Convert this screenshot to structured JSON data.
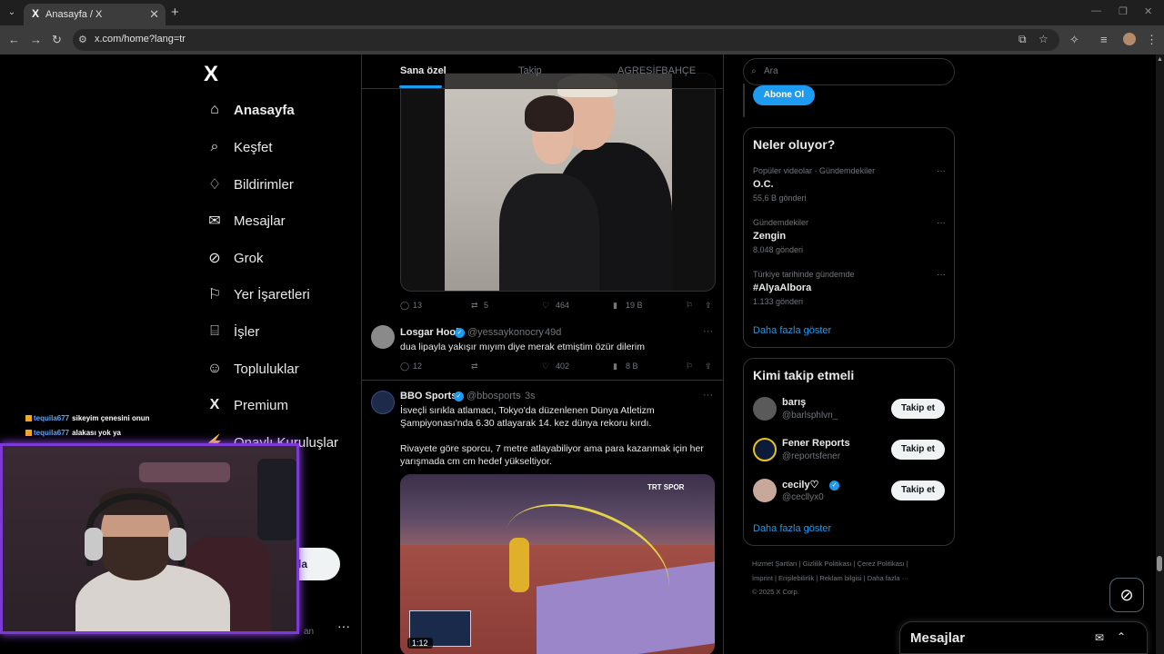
{
  "browser": {
    "tab_title": "Anasayfa / X",
    "favicon": "X",
    "url": "x.com/home?lang=tr"
  },
  "nav": {
    "logo": "X",
    "items": [
      {
        "label": "Anasayfa",
        "icon": "home-icon",
        "glyph": "⌂",
        "active": true
      },
      {
        "label": "Keşfet",
        "icon": "search-icon",
        "glyph": "⌕"
      },
      {
        "label": "Bildirimler",
        "icon": "bell-icon",
        "glyph": "♢"
      },
      {
        "label": "Mesajlar",
        "icon": "envelope-icon",
        "glyph": "✉"
      },
      {
        "label": "Grok",
        "icon": "grok-icon",
        "glyph": "⊘"
      },
      {
        "label": "Yer İşaretleri",
        "icon": "bookmark-icon",
        "glyph": "⚐"
      },
      {
        "label": "İşler",
        "icon": "briefcase-icon",
        "glyph": "⌸"
      },
      {
        "label": "Topluluklar",
        "icon": "people-icon",
        "glyph": "☺"
      },
      {
        "label": "Premium",
        "icon": "x-premium-icon",
        "glyph": "X"
      },
      {
        "label": "Onaylı Kuruluşlar",
        "icon": "lightning-icon",
        "glyph": "⚡"
      }
    ],
    "post_button": "la",
    "user_partial": "an"
  },
  "feed": {
    "tabs": [
      {
        "label": "Sana özel",
        "active": true
      },
      {
        "label": "Takip"
      },
      {
        "label": "AGRESİFBAHÇE"
      }
    ],
    "tweet1": {
      "replies": "13",
      "retweets": "5",
      "likes": "464",
      "views": "19 B"
    },
    "tweet2": {
      "name": "Losgar Hool",
      "handle": "@yessaykonocry",
      "time": "49d",
      "text": "dua lipayla yakışır mıyım diye merak etmiştim özür dilerim",
      "replies": "12",
      "retweets": "",
      "likes": "402",
      "views": "8 B"
    },
    "tweet3": {
      "name": "BBO Sports",
      "handle": "@bbosports",
      "time": "3s",
      "text1": "İsveçli sırıkla atlamacı, Tokyo'da düzenlenen Dünya Atletizm Şampiyonası'nda 6.30 atlayarak 14. kez dünya rekoru kırdı.",
      "text2": "Rivayete göre sporcu, 7 metre atlayabiliyor ama para kazanmak için her yarışmada cm cm hedef yükseltiyor.",
      "duration": "1:12",
      "broadcaster": "TRT SPOR"
    }
  },
  "sidebar": {
    "search_placeholder": "Ara",
    "subscribe": "Abone Ol",
    "trends_title": "Neler oluyor?",
    "trends": [
      {
        "meta": "Popüler videolar · Gündemdekiler",
        "name": "O.C.",
        "count": "55,6 B gönderi"
      },
      {
        "meta": "Gündemdekiler",
        "name": "Zengin",
        "count": "8.048 gönderi"
      },
      {
        "meta": "Türkiye tarihinde gündemde",
        "name": "#AlyaAlbora",
        "count": "1.133 gönderi"
      }
    ],
    "show_more": "Daha fazla göster",
    "who_title": "Kimi takip etmeli",
    "who": [
      {
        "name": "barış",
        "handle": "@barlsphlvn_",
        "follow": "Takip et"
      },
      {
        "name": "Fener Reports",
        "handle": "@reportsfener",
        "follow": "Takip et"
      },
      {
        "name": "cecily♡",
        "handle": "@cecllyx0",
        "follow": "Takip et"
      }
    ],
    "footer_line1": "Hizmet Şartları  |  Gizlilik Politikası  |  Çerez Politikası  |",
    "footer_line2": "İmprint  |  Erişilebilirlik  |  Reklam bilgisi  |  Daha fazla ···",
    "footer_line3": "© 2025 X Corp."
  },
  "messages_drawer": {
    "title": "Mesajlar"
  },
  "overlay": {
    "chat": [
      {
        "user": "tequila677",
        "msg": "sikeyim çenesini onun"
      },
      {
        "user": "tequila677",
        "msg": "alakası yok ya"
      }
    ]
  },
  "colors": {
    "accent": "#1d9bf0",
    "background": "#000000",
    "border": "#2f3336",
    "stream_frame": "#7d39d6"
  }
}
